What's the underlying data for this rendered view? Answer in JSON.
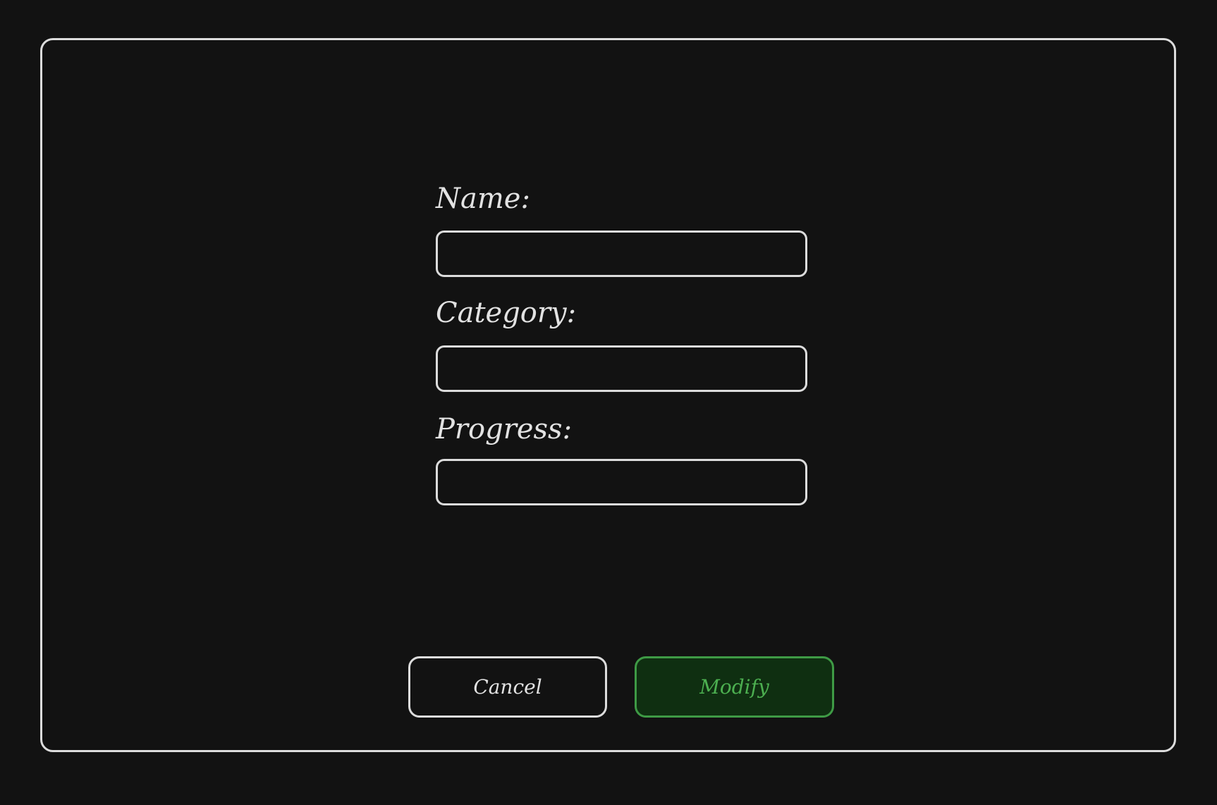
{
  "form": {
    "fields": [
      {
        "label": "Name:",
        "value": "",
        "placeholder": ""
      },
      {
        "label": "Category:",
        "value": "",
        "placeholder": ""
      },
      {
        "label": "Progress:",
        "value": "",
        "placeholder": ""
      }
    ]
  },
  "actions": {
    "cancel_label": "Cancel",
    "modify_label": "Modify"
  },
  "colors": {
    "background": "#121212",
    "border": "#dcdcdc",
    "modify_border": "#3e9a45",
    "modify_fill": "#0f2f11",
    "modify_text": "#4caf50"
  }
}
